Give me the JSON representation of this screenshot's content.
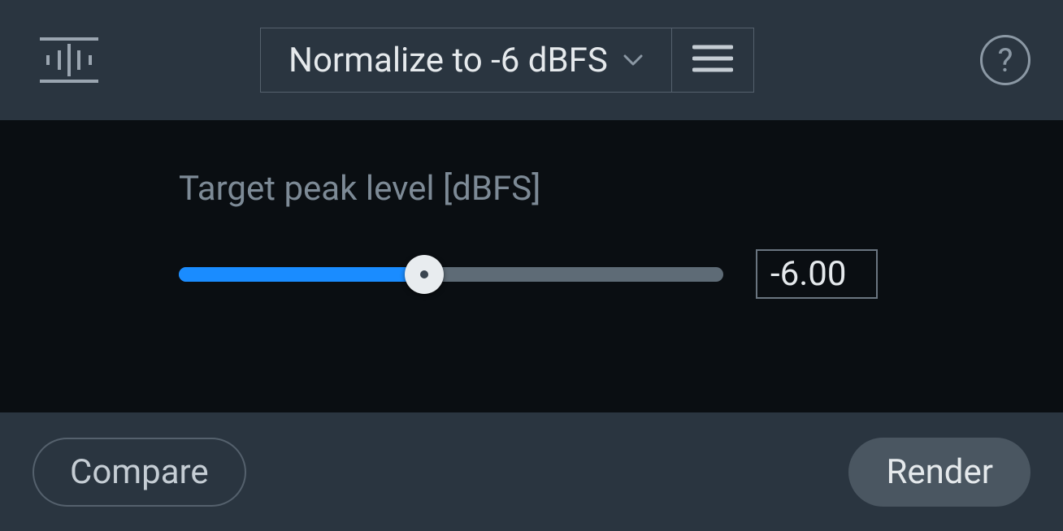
{
  "header": {
    "preset_label": "Normalize to -6 dBFS"
  },
  "main": {
    "param_label": "Target peak level [dBFS]",
    "slider_value": "-6.00",
    "slider_fill_percent": 45
  },
  "footer": {
    "compare_label": "Compare",
    "render_label": "Render"
  }
}
